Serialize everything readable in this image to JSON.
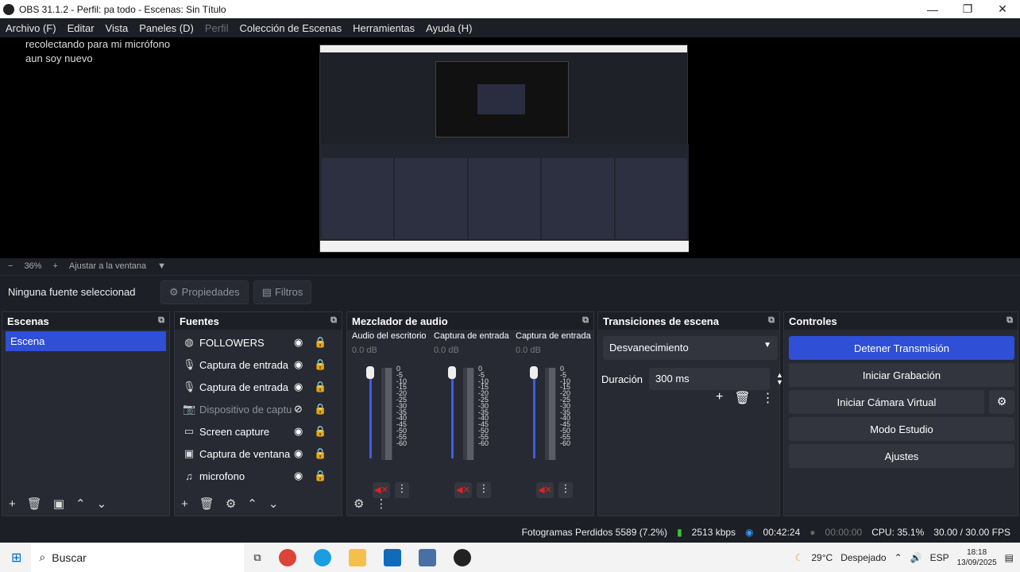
{
  "window": {
    "title": "OBS 31.1.2 - Perfil: pa todo - Escenas: Sin Título"
  },
  "menu": [
    "Archivo (F)",
    "Editar",
    "Vista",
    "Paneles (D)",
    "Perfil",
    "Colección de Escenas",
    "Herramientas",
    "Ayuda (H)"
  ],
  "chat": [
    "recolectando para mi micrófono",
    "aun soy nuevo"
  ],
  "zoom": {
    "minus": "−",
    "value": "36%",
    "plus": "+",
    "fit": "Ajustar a la ventana"
  },
  "source_bar": {
    "label": "Ninguna fuente seleccionad",
    "properties": "Propiedades",
    "filters": "Filtros"
  },
  "scenes": {
    "title": "Escenas",
    "items": [
      "Escena"
    ]
  },
  "sources": {
    "title": "Fuentes",
    "items": [
      "FOLLOWERS",
      "Captura de entrada de audio",
      "Captura de entrada de audio",
      "Dispositivo de captura",
      "Screen capture",
      "Captura de ventana",
      "microfono"
    ]
  },
  "mixer": {
    "title": "Mezclador de audio",
    "channels": [
      {
        "name": "Audio del escritorio",
        "db": "0.0 dB"
      },
      {
        "name": "Captura de entrada",
        "db": "0.0 dB"
      },
      {
        "name": "Captura de entrada",
        "db": "0.0 dB"
      }
    ],
    "ticks": [
      "0",
      "-5",
      "-10",
      "-15",
      "-20",
      "-25",
      "-30",
      "-35",
      "-40",
      "-45",
      "-50",
      "-55",
      "-60"
    ]
  },
  "transitions": {
    "title": "Transiciones de escena",
    "selected": "Desvanecimiento",
    "duration_label": "Duración",
    "duration": "300 ms"
  },
  "controls": {
    "title": "Controles",
    "stop": "Detener Transmisión",
    "record": "Iniciar Grabación",
    "virtual": "Iniciar Cámara Virtual",
    "studio": "Modo Estudio",
    "settings": "Ajustes"
  },
  "status": {
    "dropped": "Fotogramas Perdidos 5589 (7.2%)",
    "kbps": "2513 kbps",
    "stream_time": "00:42:24",
    "rec_time": "00:00:00",
    "cpu": "CPU: 35.1%",
    "fps": "30.00 / 30.00 FPS"
  },
  "taskbar": {
    "search": "Buscar",
    "weather_temp": "29°C",
    "weather": "Despejado",
    "lang": "ESP",
    "time": "18:18",
    "date": "13/09/2025"
  }
}
